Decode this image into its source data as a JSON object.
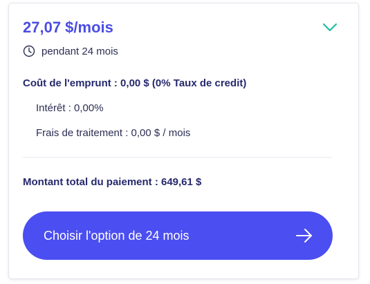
{
  "plan": {
    "price": "27,07 $/mois",
    "duration": "pendant 24 mois",
    "cost_heading": "Coût de l'emprunt : 0,00 $ (0% Taux de credit)",
    "interest": "Intérêt : 0,00%",
    "fees": "Frais de traitement : 0,00 $ / mois",
    "total": "Montant total du paiement : 649,61 $",
    "cta_label": "Choisir l'option de 24 mois"
  },
  "colors": {
    "accent": "#4b4ef0",
    "price_text": "#4b4de4",
    "chevron": "#1bbf9c",
    "heading_text": "#26296d"
  },
  "icons": {
    "duration": "clock-icon",
    "expand": "chevron-down-icon",
    "cta": "arrow-right-icon"
  }
}
